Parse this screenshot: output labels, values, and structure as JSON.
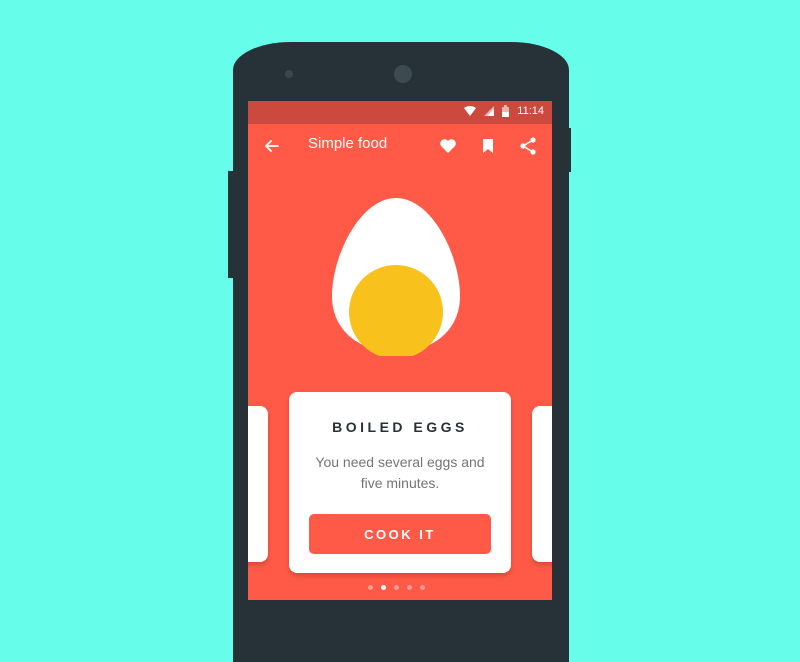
{
  "status_bar": {
    "time": "11:14",
    "icons": [
      "wifi-icon",
      "signal-icon",
      "battery-icon"
    ]
  },
  "app_bar": {
    "title": "Simple food",
    "back_icon": "arrow-left-icon",
    "actions": [
      "heart-icon",
      "bookmark-icon",
      "share-icon"
    ]
  },
  "recipe": {
    "title": "BOILED EGGS",
    "description": "You need several eggs and five minutes.",
    "button_label": "COOK IT",
    "image": "boiled-egg-illustration"
  },
  "pager": {
    "total": 5,
    "active_index": 1
  },
  "colors": {
    "background": "#66fdeb",
    "primary": "#ff5a48",
    "status_bar": "#cc4a3d",
    "phone_frame": "#263238",
    "yolk": "#f8c11c"
  }
}
